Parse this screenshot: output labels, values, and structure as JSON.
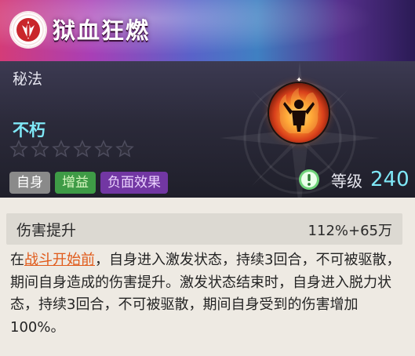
{
  "header": {
    "title": "狱血狂燃",
    "emblem_icon": "clan-crest-icon"
  },
  "skill": {
    "category": "秘法",
    "name": "不朽",
    "stars_total": 6,
    "stars_filled": 0,
    "tags": [
      "自身",
      "增益",
      "负面效果"
    ],
    "icon": "flame-figure-icon",
    "level_label": "等级",
    "level_value": "240",
    "level_alert_icon": "exclamation-circle-icon"
  },
  "stat": {
    "label": "伤害提升",
    "value": "112%+65万"
  },
  "description": {
    "prefix": "在",
    "highlight": "战斗开始前",
    "rest": "，自身进入激发状态，持续3回合，不可被驱散，期间自身造成的伤害提升。激发状态结束时，自身进入脱力状态，持续3回合，不可被驱散，期间自身受到的伤害增加100%。"
  },
  "colors": {
    "accent_cyan": "#7fe8f7",
    "highlight_orange": "#e05a1a",
    "tag_buff": "#3e9b46",
    "tag_debuff": "#7237a3"
  }
}
